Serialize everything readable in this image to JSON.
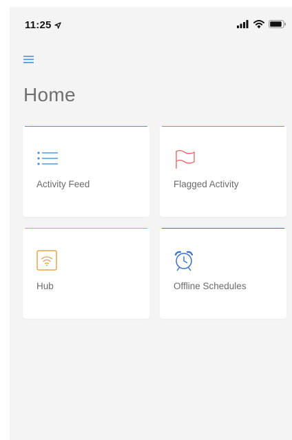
{
  "status_bar": {
    "time": "11:25"
  },
  "header": {
    "title": "Home",
    "menu_icon": "hamburger-menu-icon"
  },
  "cards": [
    {
      "label": "Activity Feed",
      "icon": "list-icon",
      "accent_color": "#4a90d9",
      "icon_color": "#4a90d9"
    },
    {
      "label": "Flagged Activity",
      "icon": "flag-icon",
      "accent_color": "#e06c6c",
      "icon_color": "#e06c6c"
    },
    {
      "label": "Hub",
      "icon": "wifi-hub-icon",
      "accent_color": "#e8a040",
      "icon_color": "#e8a040"
    },
    {
      "label": "Offline Schedules",
      "icon": "alarm-clock-icon",
      "accent_color": "#3b6fc4",
      "icon_color": "#3b6fc4"
    }
  ],
  "colors": {
    "menu": "#4a90d9",
    "background": "#f4f4f4",
    "card": "#ffffff",
    "label_text": "#6a6a6a",
    "title_text": "#6f6f6f"
  }
}
